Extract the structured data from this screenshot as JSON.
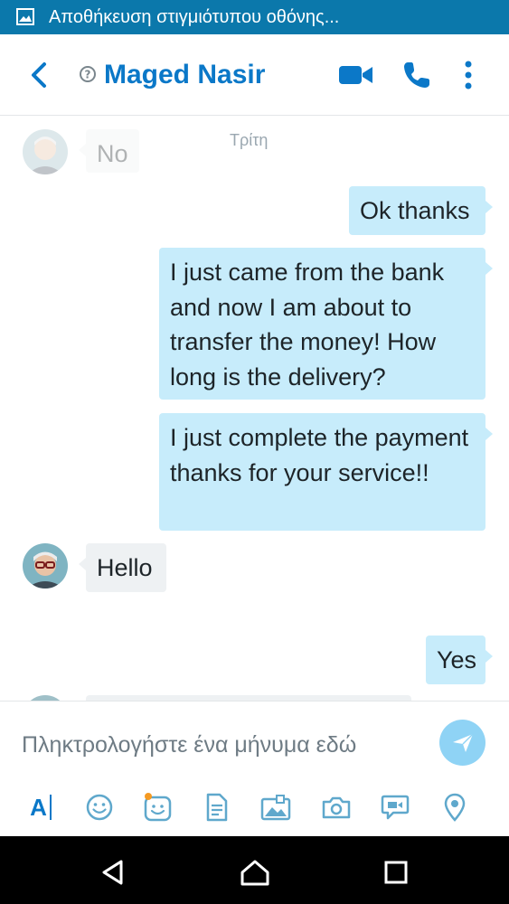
{
  "status_bar": {
    "notification_text": "Αποθήκευση στιγμιότυπου οθόνης...",
    "icon": "image-icon"
  },
  "header": {
    "back_icon": "chevron-left-icon",
    "presence_icon": "unknown-presence-icon",
    "contact_name": "Maged Nasir",
    "actions": [
      "video-call-icon",
      "phone-icon",
      "more-vertical-icon"
    ]
  },
  "chat": {
    "day_label": "Τρίτη",
    "messages": [
      {
        "direction": "in",
        "text": "No",
        "faded": true
      },
      {
        "direction": "out",
        "text": "Ok thanks"
      },
      {
        "direction": "out",
        "text": "I just came from the bank and now I am about to transfer the money! How long is the delivery?"
      },
      {
        "direction": "out",
        "text": "I just complete the payment thanks for your service!!"
      },
      {
        "direction": "in",
        "text": "Hello"
      },
      {
        "direction": "out",
        "text": "Yes"
      }
    ]
  },
  "composer": {
    "placeholder": "Πληκτρολογήστε ένα μήνυμα εδώ",
    "value": "",
    "send_icon": "send-icon",
    "tools": [
      "text-format-icon",
      "emoticon-icon",
      "moji-icon",
      "file-icon",
      "photo-gallery-icon",
      "camera-icon",
      "video-message-icon",
      "location-icon"
    ],
    "text_tool_label": "A"
  },
  "navbar": {
    "buttons": [
      "back-triangle-icon",
      "home-icon",
      "recents-icon"
    ]
  },
  "colors": {
    "status_bar": "#0b78ab",
    "accent": "#0b78c8",
    "outgoing_bubble": "#c7ecfb",
    "incoming_bubble": "#eef1f3",
    "send_button": "#8fd3f5",
    "notification_dot": "#f59a23"
  }
}
